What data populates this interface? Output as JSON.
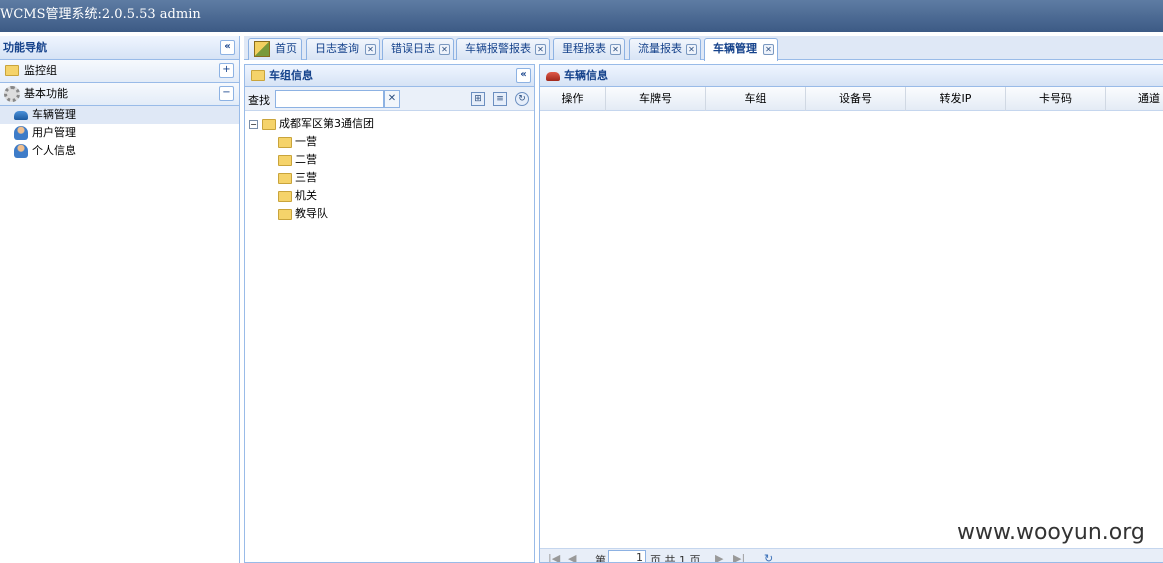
{
  "app": {
    "title": "WCMS管理系统:2.0.5.53 admin"
  },
  "nav": {
    "title": "功能导航",
    "collapse_icon": "«",
    "groups": [
      {
        "label": "监控组",
        "toggle": "+"
      },
      {
        "label": "基本功能",
        "toggle": "−"
      }
    ],
    "items": [
      {
        "label": "车辆管理"
      },
      {
        "label": "用户管理"
      },
      {
        "label": "个人信息"
      }
    ]
  },
  "tabs": [
    {
      "label": "首页"
    },
    {
      "label": "日志查询"
    },
    {
      "label": "错误日志"
    },
    {
      "label": "车辆报警报表"
    },
    {
      "label": "里程报表"
    },
    {
      "label": "流量报表"
    },
    {
      "label": "车辆管理"
    }
  ],
  "vehicle_group_panel": {
    "title": "车组信息",
    "search_label": "查找",
    "search_value": "",
    "clear_icon": "✕",
    "tree": {
      "root": {
        "label": "成都军区第3通信团",
        "expander": "−"
      },
      "children": [
        {
          "label": "一营"
        },
        {
          "label": "二营"
        },
        {
          "label": "三营"
        },
        {
          "label": "机关"
        },
        {
          "label": "教导队"
        }
      ]
    }
  },
  "vehicle_info_panel": {
    "title": "车辆信息",
    "columns": [
      "操作",
      "车牌号",
      "车组",
      "设备号",
      "转发IP",
      "卡号码",
      "通道"
    ],
    "pager": {
      "prefix": "第",
      "page": "1",
      "suffix": "页 共 1 页"
    }
  },
  "watermark": "www.wooyun.org",
  "colors": {
    "titlebar": "#3c5a85",
    "header_text": "#15428b",
    "border": "#99bbe8"
  }
}
